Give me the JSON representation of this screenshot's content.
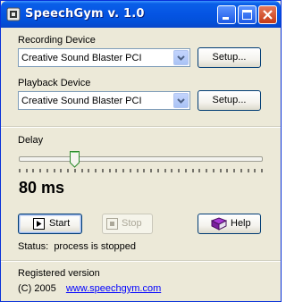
{
  "window": {
    "title": "SpeechGym v. 1.0",
    "controls": {
      "minimize": "minimize-icon",
      "maximize": "maximize-icon",
      "close": "close-icon"
    }
  },
  "recording": {
    "label": "Recording Device",
    "selected": "Creative Sound Blaster PCI",
    "setup_label": "Setup..."
  },
  "playback": {
    "label": "Playback Device",
    "selected": "Creative Sound Blaster PCI",
    "setup_label": "Setup..."
  },
  "delay": {
    "label": "Delay",
    "value_text": "80 ms",
    "slider_fraction": 0.22
  },
  "actions": {
    "start_label": "Start",
    "stop_label": "Stop",
    "help_label": "Help",
    "stop_enabled": false
  },
  "status": {
    "prefix": "Status:",
    "text": "process is stopped"
  },
  "footer": {
    "registered": "Registered version",
    "copyright": "(C) 2005",
    "website": "www.speechgym.com"
  },
  "colors": {
    "titlebar": "#0554e3",
    "dialog_bg": "#ece9d8",
    "link": "#0000ff"
  }
}
